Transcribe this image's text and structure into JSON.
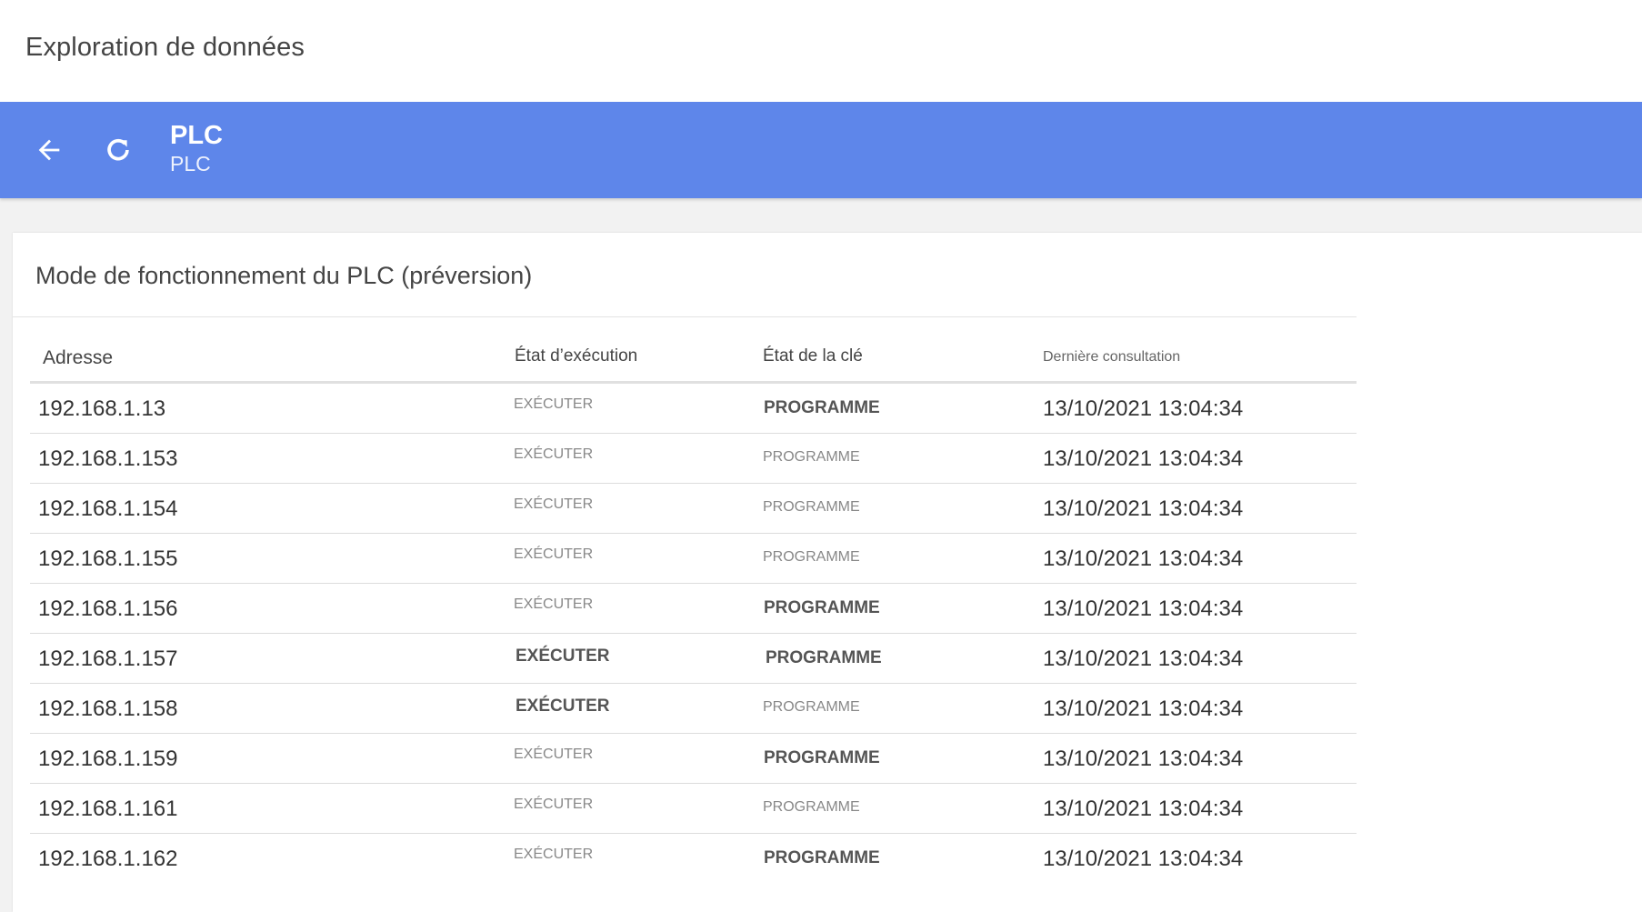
{
  "app": {
    "title": "Exploration de données"
  },
  "header": {
    "title": "PLC",
    "subtitle": "PLC",
    "back_icon": "arrow-left-icon",
    "refresh_icon": "refresh-icon",
    "color": "#5e86ea"
  },
  "card": {
    "title": "Mode de fonctionnement du PLC (préversion)"
  },
  "table": {
    "columns": [
      "Adresse",
      "État d’exécution",
      "État de la clé",
      "Dernière consultation"
    ],
    "rows": [
      {
        "address": "192.168.1.13",
        "run_state": "EXÉCUTER",
        "key_state": "PROGRAMME",
        "last_seen": "13/10/2021 13:04:34"
      },
      {
        "address": "192.168.1.153",
        "run_state": "EXÉCUTER",
        "key_state": "PROGRAMME",
        "last_seen": "13/10/2021 13:04:34"
      },
      {
        "address": "192.168.1.154",
        "run_state": "EXÉCUTER",
        "key_state": "PROGRAMME",
        "last_seen": "13/10/2021 13:04:34"
      },
      {
        "address": "192.168.1.155",
        "run_state": "EXÉCUTER",
        "key_state": "PROGRAMME",
        "last_seen": "13/10/2021 13:04:34"
      },
      {
        "address": "192.168.1.156",
        "run_state": "EXÉCUTER",
        "key_state": "PROGRAMME",
        "last_seen": "13/10/2021 13:04:34"
      },
      {
        "address": "192.168.1.157",
        "run_state": "EXÉCUTER",
        "key_state": "PROGRAMME",
        "last_seen": "13/10/2021 13:04:34"
      },
      {
        "address": "192.168.1.158",
        "run_state": "EXÉCUTER",
        "key_state": "PROGRAMME",
        "last_seen": "13/10/2021 13:04:34"
      },
      {
        "address": "192.168.1.159",
        "run_state": "EXÉCUTER",
        "key_state": "PROGRAMME",
        "last_seen": "13/10/2021 13:04:34"
      },
      {
        "address": "192.168.1.161",
        "run_state": "EXÉCUTER",
        "key_state": "PROGRAMME",
        "last_seen": "13/10/2021 13:04:34"
      },
      {
        "address": "192.168.1.162",
        "run_state": "EXÉCUTER",
        "key_state": "PROGRAMME",
        "last_seen": "13/10/2021 13:04:34"
      }
    ]
  }
}
